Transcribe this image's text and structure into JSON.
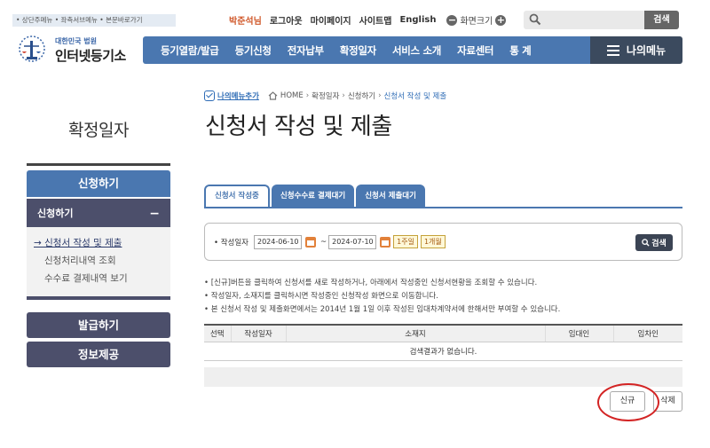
{
  "skip_links": "• 상단주메뉴 • 좌측서브메뉴 • 본문바로가기",
  "util": {
    "user": "박준석님",
    "logout": "로그아웃",
    "mypage": "마이페이지",
    "sitemap": "사이트맵",
    "english": "English",
    "zoom_label": "화면크기",
    "zoom_minus": "−",
    "zoom_plus": "+"
  },
  "search": {
    "button": "검색",
    "placeholder": ""
  },
  "logo": {
    "small": "대한민국 법원",
    "big": "인터넷등기소"
  },
  "gnb": [
    "등기열람/발급",
    "등기신청",
    "전자납부",
    "확정일자",
    "서비스 소개",
    "자료센터",
    "통 계"
  ],
  "mymenu": "나의메뉴",
  "sidebar": {
    "title": "확정일자",
    "section": "신청하기",
    "sub": "신청하기",
    "sub_toggle": "−",
    "items": [
      "→ 신청서 작성 및 제출",
      "신청처리내역 조회",
      "수수료 결제내역 보기"
    ],
    "btn_issue": "발급하기",
    "btn_info": "정보제공"
  },
  "breadcrumb": {
    "fav": "나의메뉴추가",
    "home": "HOME",
    "sep": "›",
    "l1": "확정일자",
    "l2": "신청하기",
    "current": "신청서 작성 및 제출"
  },
  "page_title": "신청서 작성 및 제출",
  "tabs": [
    "신청서 작성중",
    "신청수수료 결제대기",
    "신청서 제출대기"
  ],
  "filter": {
    "label": "• 작성일자",
    "from": "2024-06-10",
    "tilde": "~",
    "to": "2024-07-10",
    "week": "1주일",
    "month": "1개월",
    "search": "검색"
  },
  "notes": [
    "• [신규]버튼을 클릭하여 신청서를 새로 작성하거나, 아래에서 작성중인 신청서현황을 조회할 수 있습니다.",
    "• 작성일자, 소재지를 클릭하시면 작성중인 신청작성 화면으로 이동합니다.",
    "• 본 신청서 작성 및 제출화면에서는 2014년 1월 1일 이후 작성된 임대차계약서에 한해서만 부여할 수 있습니다."
  ],
  "table": {
    "headers": [
      "선택",
      "작성일자",
      "소재지",
      "임대인",
      "임차인"
    ],
    "empty": "검색결과가 없습니다."
  },
  "buttons": {
    "new": "신규",
    "delete": "삭제"
  },
  "colors": {
    "primary": "#4a77b0",
    "dark": "#4c4f6b",
    "highlight": "#d32424"
  }
}
